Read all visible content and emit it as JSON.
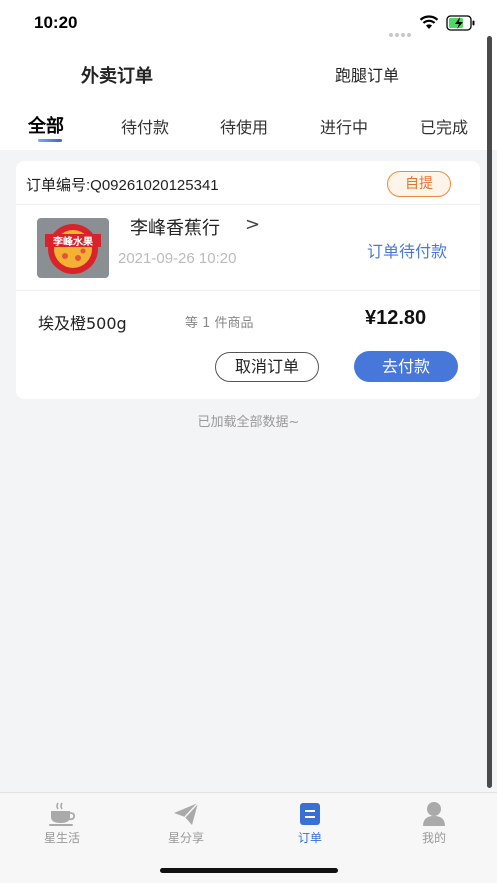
{
  "status_bar": {
    "time": "10:20"
  },
  "header": {
    "order_types": [
      "外卖订单",
      "跑腿订单"
    ],
    "active_order_type": "外卖订单"
  },
  "tabs": [
    {
      "label": "全部",
      "active": true
    },
    {
      "label": "待付款",
      "active": false
    },
    {
      "label": "待使用",
      "active": false
    },
    {
      "label": "进行中",
      "active": false
    },
    {
      "label": "已完成",
      "active": false
    }
  ],
  "order": {
    "order_no": "订单编号:Q09261020125341",
    "badge": "自提",
    "store_name": "李峰香蕉行",
    "store_chevron": ">",
    "store_logo_text": "李峰水果",
    "time": "2021-09-26 10:20",
    "status": "订单待付款",
    "product_name": "埃及橙500g",
    "product_count": "等 1 件商品",
    "price": "¥12.80",
    "cancel_label": "取消订单",
    "pay_label": "去付款"
  },
  "list_footer": "已加载全部数据~",
  "tabbar": [
    {
      "label": "星生活",
      "icon": "coffee-cup-icon",
      "active": false
    },
    {
      "label": "星分享",
      "icon": "paper-plane-icon",
      "active": false
    },
    {
      "label": "订单",
      "icon": "order-list-icon",
      "active": true
    },
    {
      "label": "我的",
      "icon": "user-icon",
      "active": false
    }
  ],
  "colors": {
    "accent": "#4677d9",
    "badge_orange": "#e8742a",
    "status_blue": "#4a7ad8",
    "background": "#f3f4f6"
  }
}
